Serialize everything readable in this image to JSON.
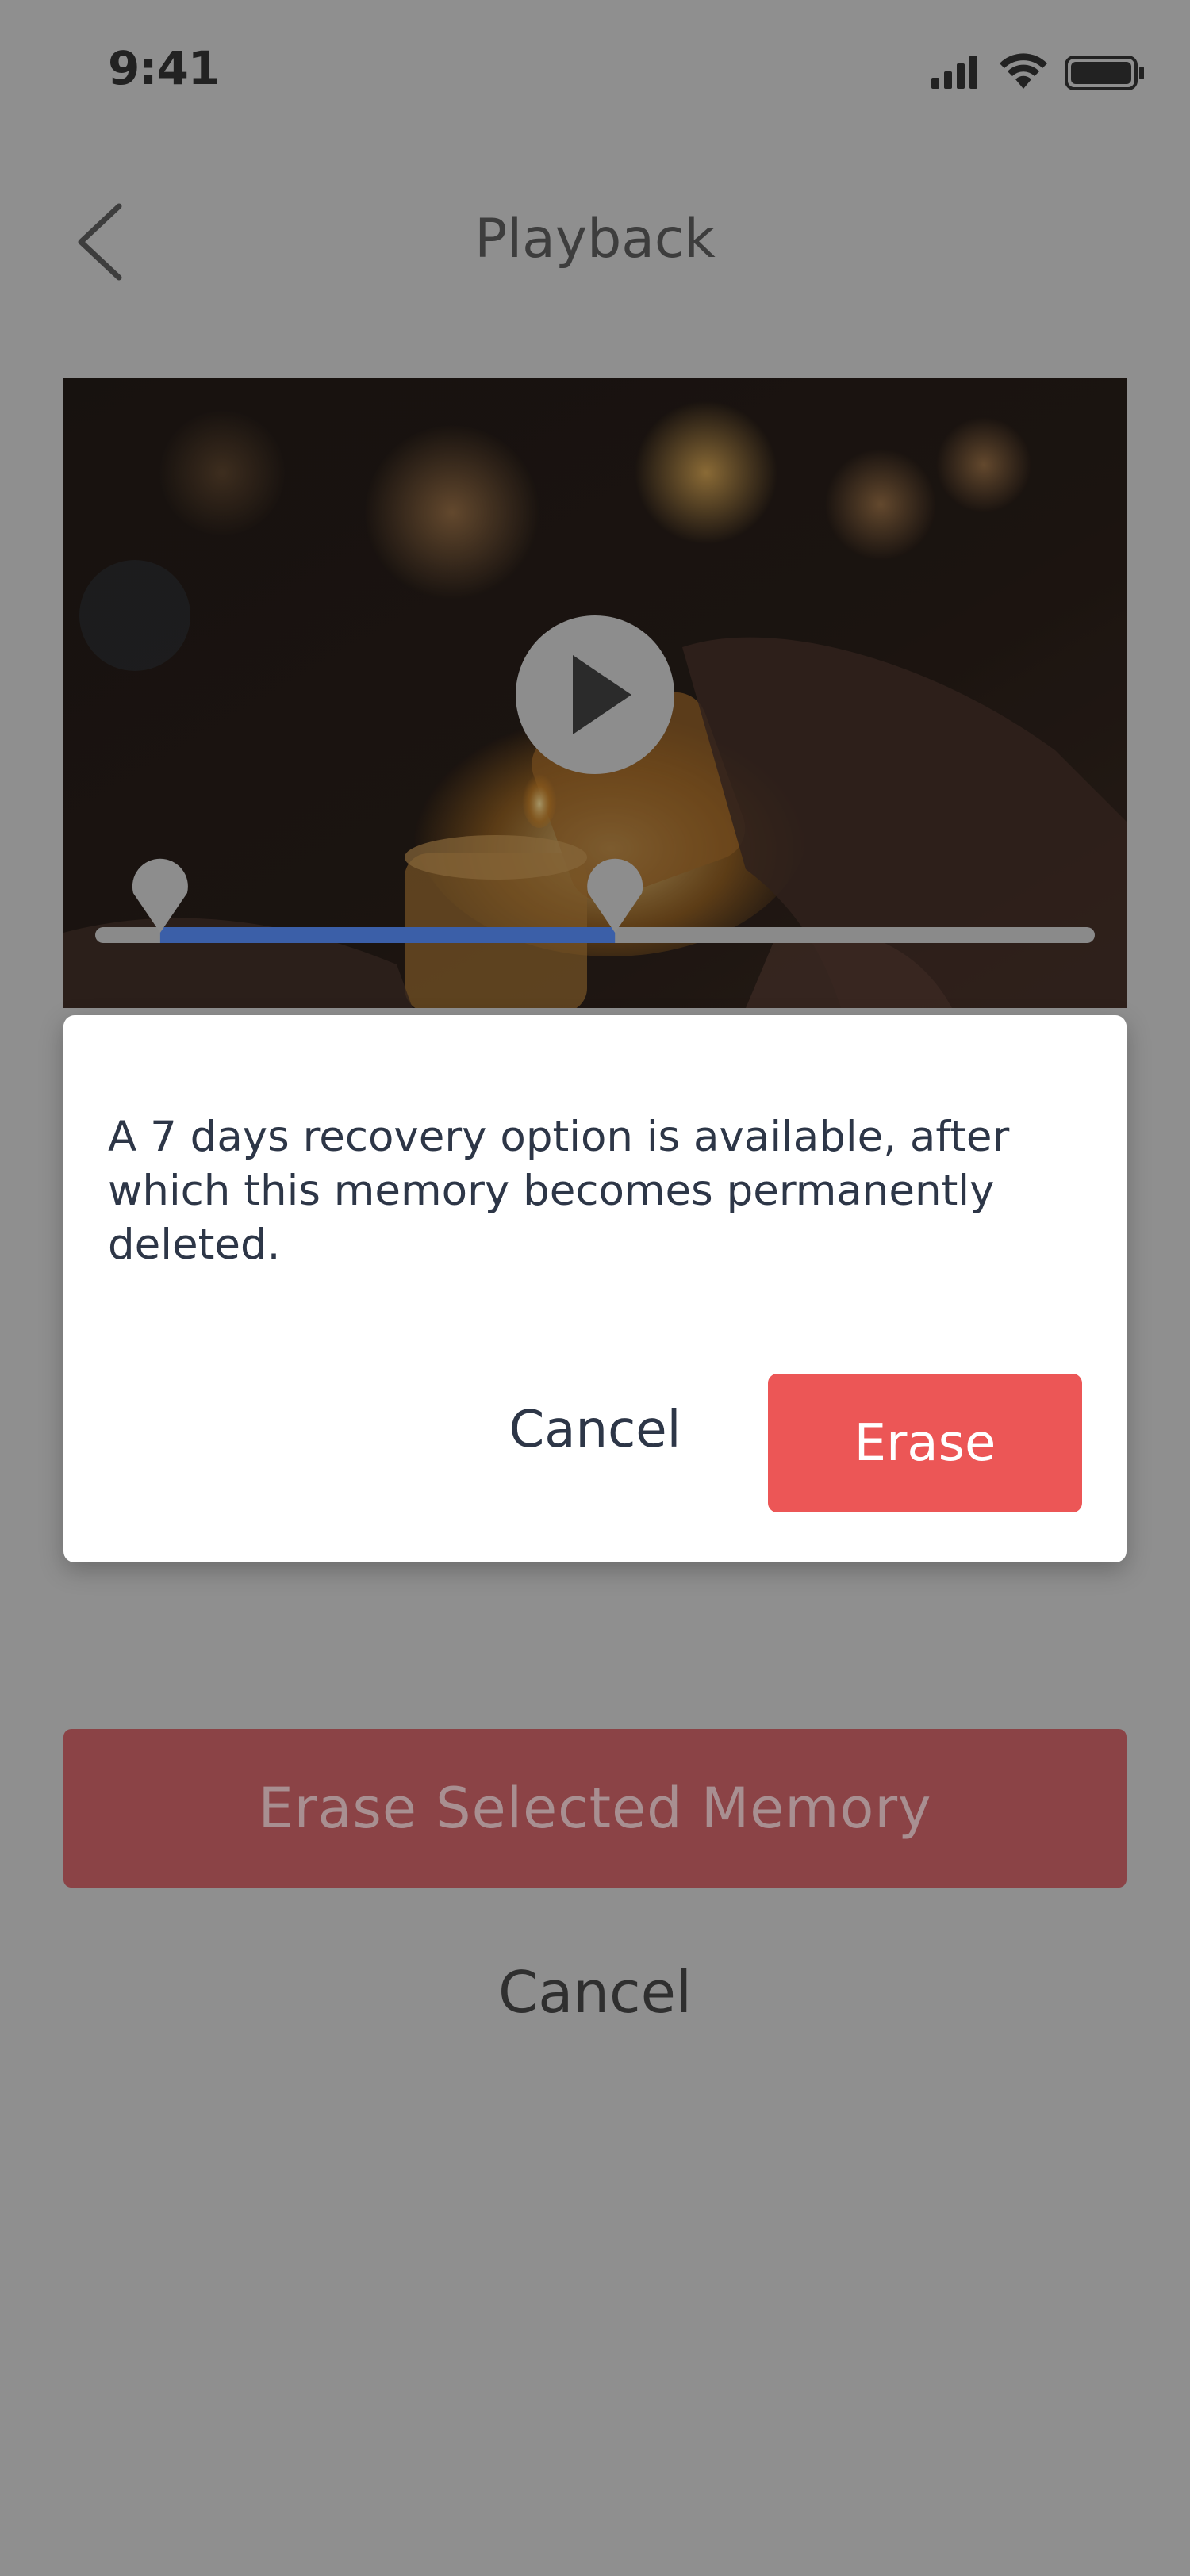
{
  "status_bar": {
    "time": "9:41"
  },
  "header": {
    "title": "Playback"
  },
  "video": {
    "trim_start_fraction": 0.065,
    "trim_end_fraction": 0.52
  },
  "dialog": {
    "message": "A 7 days recovery option is available, after which this memory becomes permanently deleted.",
    "cancel_label": "Cancel",
    "erase_label": "Erase"
  },
  "actions": {
    "erase_selected_label": "Erase Selected Memory",
    "cancel_label": "Cancel"
  },
  "colors": {
    "overlay_background": "#8f8f8f",
    "erase_button": "#ec5656",
    "progress_fill": "#3b5fa8"
  }
}
